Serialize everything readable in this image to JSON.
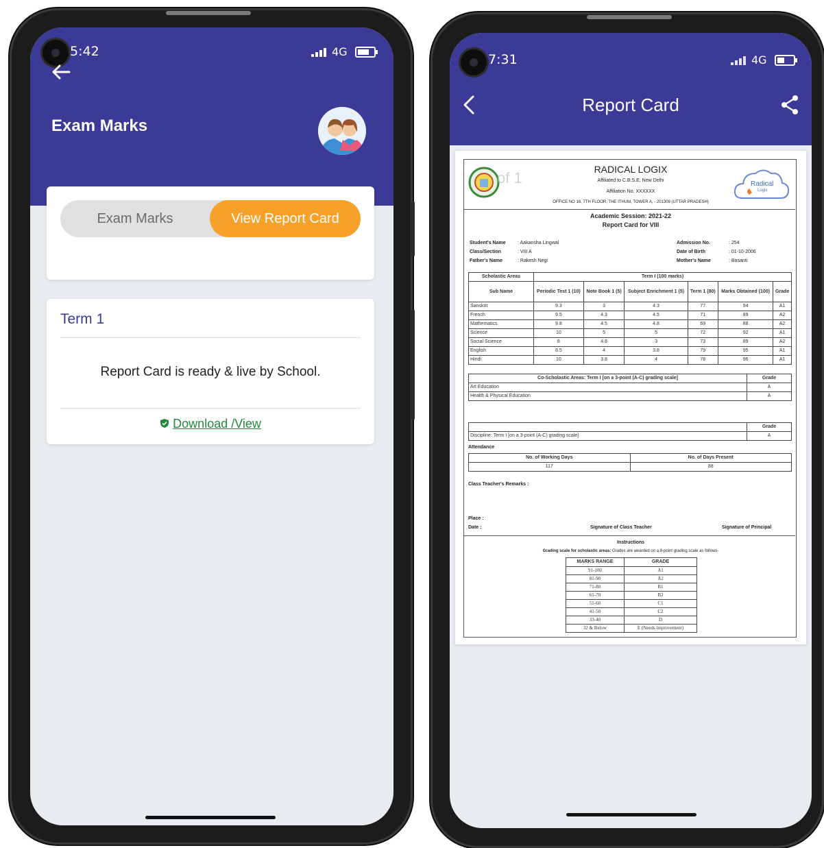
{
  "left": {
    "status": {
      "time": "5:42",
      "network": "4G"
    },
    "header_title": "Exam Marks",
    "toggle": {
      "left_label": "Exam Marks",
      "right_label": "View Report Card"
    },
    "term_card": {
      "title": "Term 1",
      "message": "Report Card is ready & live by School.",
      "download_label": "Download /View"
    },
    "colors": {
      "primary": "#3b3a96",
      "accent": "#f5a12a",
      "link": "#1e8a3a"
    }
  },
  "right": {
    "status": {
      "time": "7:31",
      "network": "4G"
    },
    "header_title": "Report Card",
    "report": {
      "page_overlay": "of 1",
      "school": "RADICAL LOGIX",
      "affiliation": "Affiliated to C.B.S.E, New Delhi",
      "affiliation_no": "Affiliation No. XXXXXX",
      "address": "OFFICE NO 16, 7TH FLOOR, THE ITHUM, TOWER A, - 201309 (UTTAR PRADESH)",
      "logo_text": "Radical",
      "logo_sub": "Logix",
      "session": "Academic Session: 2021-22",
      "class_title": "Report Card for VIII",
      "student": {
        "name_label": "Student's Name",
        "name": ": Aakansha Lingwal",
        "class_label": "Class/Section",
        "class": ": VIII A",
        "father_label": "Father's Name",
        "father": ": Rakesh Negi",
        "adm_label": "Admission No.",
        "adm": ": 254",
        "dob_label": "Date of Birth",
        "dob": ": 01-10-2006",
        "mother_label": "Mother's Name",
        "mother": ": Basanti"
      },
      "scholastic": {
        "area_header": "Scholastic Areas",
        "term_header": "Term I (100 marks)",
        "columns": [
          "Sub Name",
          "Periodic Test 1 (10)",
          "Note Book 1 (5)",
          "Subject Enrichment 1 (5)",
          "Term 1 (80)",
          "Marks Obtained (100)",
          "Grade"
        ],
        "rows": [
          [
            "Sanskrit",
            "9.3",
            "3",
            "4.3",
            "77",
            "94",
            "A1"
          ],
          [
            "French",
            "9.5",
            "4.3",
            "4.5",
            "71",
            "89",
            "A2"
          ],
          [
            "Mathematics",
            "9.8",
            "4.5",
            "4.8",
            "69",
            "88",
            "A2"
          ],
          [
            "Science",
            "10",
            "5",
            "5",
            "72",
            "92",
            "A1"
          ],
          [
            "Social Science",
            "8",
            "4.8",
            "3",
            "73",
            "89",
            "A2"
          ],
          [
            "English",
            "8.5",
            "4",
            "3.8",
            "79",
            "95",
            "A1"
          ],
          [
            "Hindi",
            "10",
            "3.8",
            "4",
            "78",
            "96",
            "A1"
          ]
        ]
      },
      "coscholastic": {
        "header": "Co-Scholastic Areas: Term I [on a 3-point (A-C) grading scale]",
        "grade_header": "Grade",
        "rows": [
          [
            "Art Education",
            "A"
          ],
          [
            "Health & Physical Education",
            "A"
          ]
        ]
      },
      "discipline": {
        "grade_header": "Grade",
        "label": "Discipline: Term I [on a 3-point (A-C) grading scale]",
        "grade": "A"
      },
      "attendance": {
        "title": "Attendance",
        "working_label": "No. of Working Days",
        "present_label": "No. of Days Present",
        "working": "117",
        "present": "88"
      },
      "remarks_label": "Class Teacher's Remarks :",
      "place_label": "Place :",
      "date_label": "Date :",
      "sig_teacher": "Signature of Class Teacher",
      "sig_principal": "Signature of Principal",
      "instructions_title": "Instructions",
      "grading_bold": "Grading scale for scholastic areas:",
      "grading_text": "Grades are awarded on a 8-point grading scale as follows-",
      "grade_scale": {
        "headers": [
          "MARKS RANGE",
          "GRADE"
        ],
        "rows": [
          [
            "91-100",
            "A1"
          ],
          [
            "81-90",
            "A2"
          ],
          [
            "71-80",
            "B1"
          ],
          [
            "61-70",
            "B2"
          ],
          [
            "51-60",
            "C1"
          ],
          [
            "41-50",
            "C2"
          ],
          [
            "33-40",
            "D"
          ],
          [
            "32 & Below",
            "E (Needs improvement)"
          ]
        ]
      }
    }
  }
}
